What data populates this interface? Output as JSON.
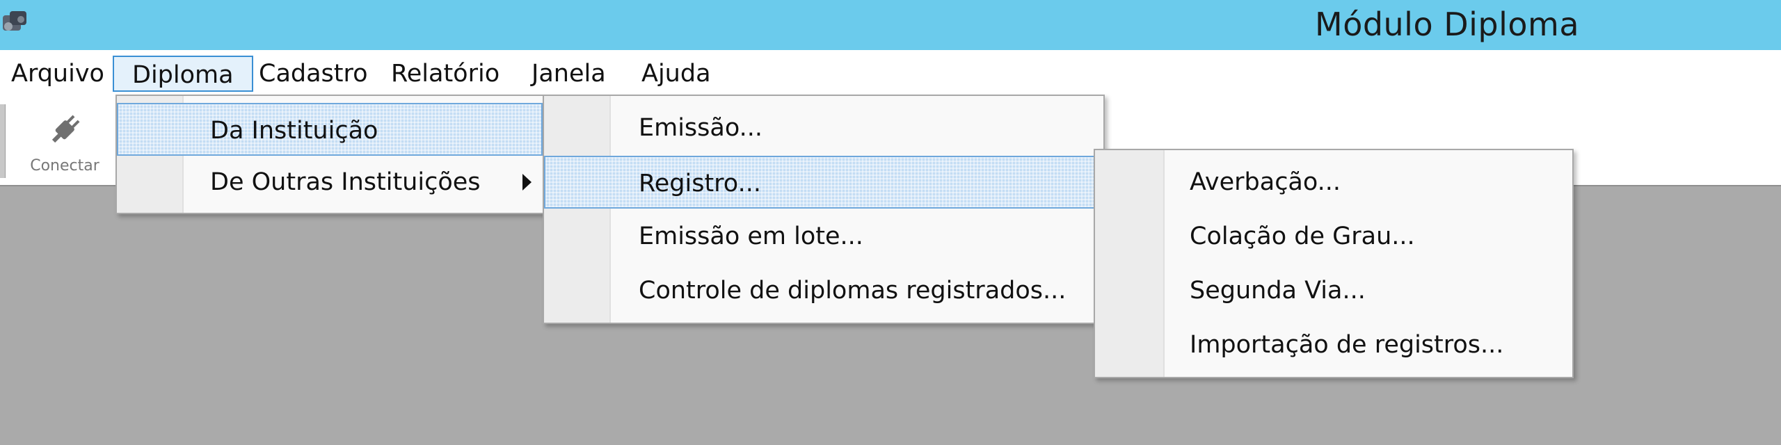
{
  "window": {
    "title": "Módulo Diploma",
    "app_icon": "app-logo-icon"
  },
  "menubar": {
    "items": [
      {
        "label": "Arquivo"
      },
      {
        "label": "Diploma"
      },
      {
        "label": "Cadastro"
      },
      {
        "label": "Relatório"
      },
      {
        "label": "Janela"
      },
      {
        "label": "Ajuda"
      }
    ],
    "active_index": 1
  },
  "toolbar": {
    "connect": {
      "label": "Conectar",
      "icon": "plug-icon"
    }
  },
  "menu_diploma": {
    "items": [
      {
        "label": "Da Instituição"
      },
      {
        "label": "De Outras Instituições"
      }
    ],
    "selected_index": 0
  },
  "menu_da_instituicao": {
    "items": [
      {
        "label": "Emissão..."
      },
      {
        "label": "Registro..."
      },
      {
        "label": "Emissão em lote..."
      },
      {
        "label": "Controle de diplomas registrados..."
      }
    ],
    "selected_index": 1
  },
  "menu_registro": {
    "items": [
      {
        "label": "Averbação..."
      },
      {
        "label": "Colação de Grau..."
      },
      {
        "label": "Segunda Via..."
      },
      {
        "label": "Importação de registros..."
      }
    ]
  },
  "colors": {
    "titlebar": "#6bcbec",
    "selection": "#c4ddf4",
    "selection_border": "#6fa8dc",
    "workspace": "#aaaaaa"
  }
}
